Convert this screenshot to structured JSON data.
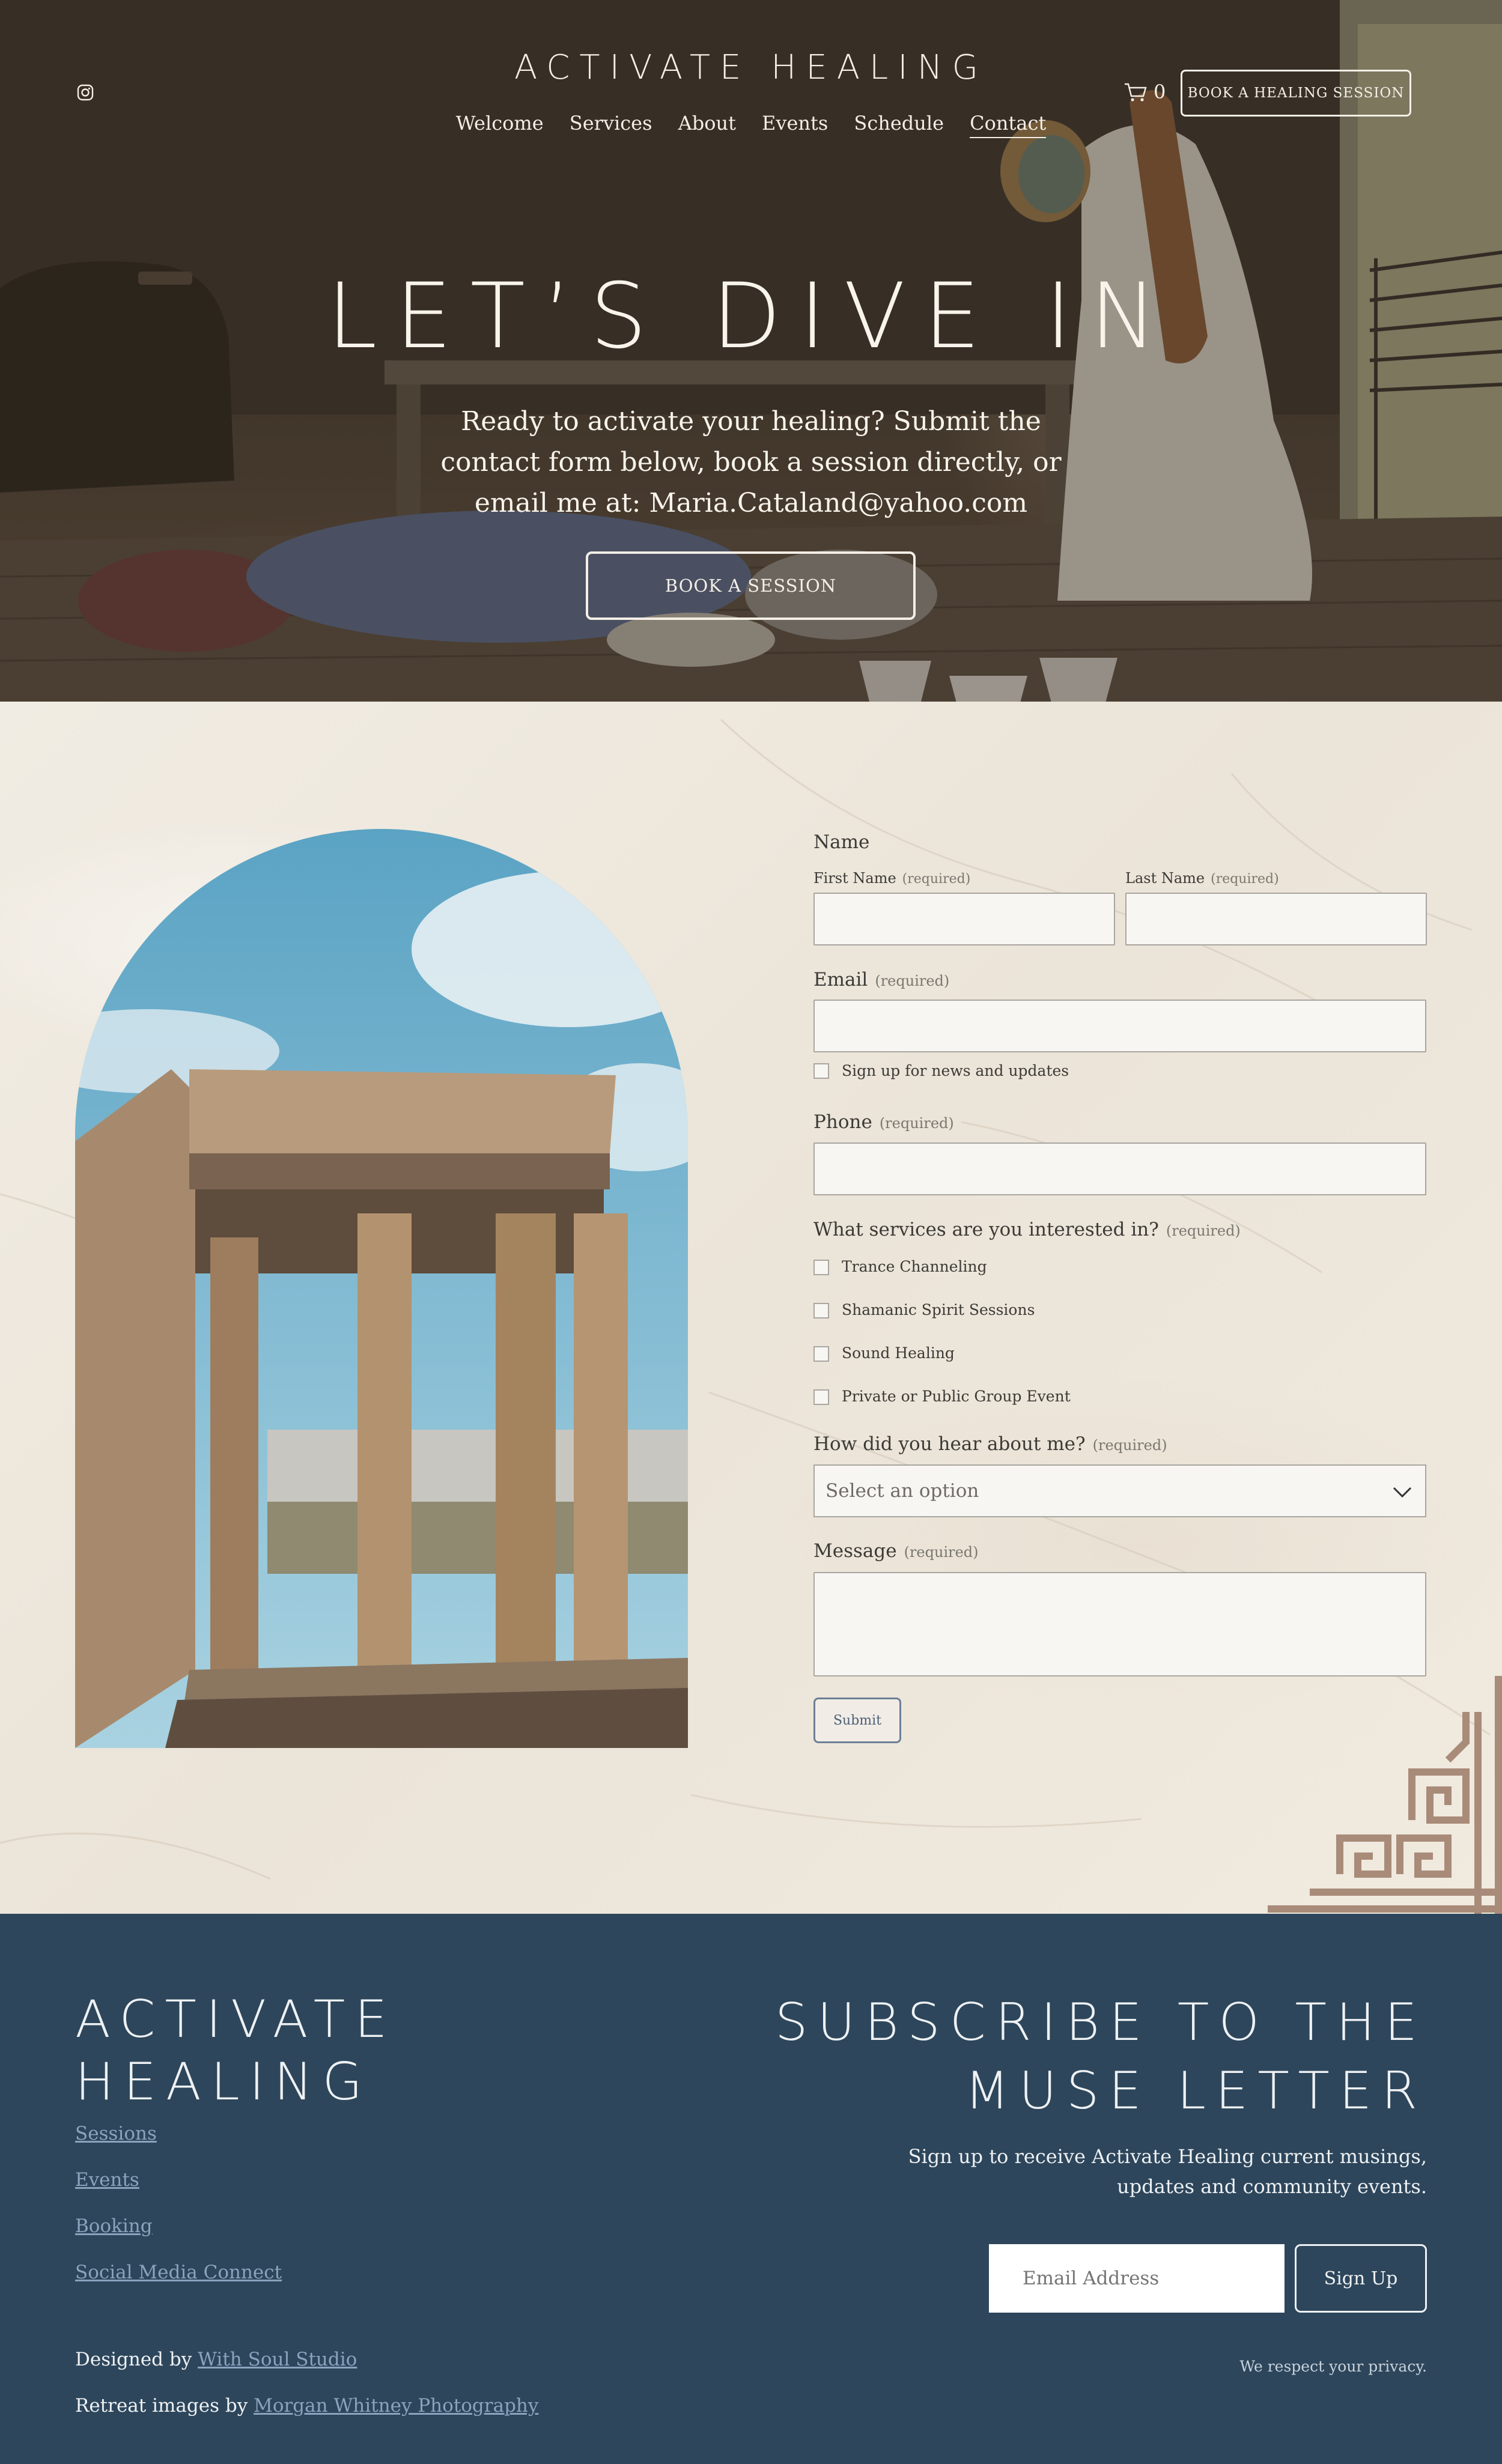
{
  "header": {
    "brand": "ACTIVATE HEALING",
    "nav": [
      "Welcome",
      "Services",
      "About",
      "Events",
      "Schedule",
      "Contact"
    ],
    "active_nav": "Contact",
    "cart_count": "0",
    "book_button": "BOOK A HEALING SESSION"
  },
  "hero": {
    "title": "LET’S DIVE IN",
    "text": "Ready to activate your healing? Submit the contact form below, book a session directly, or email me at: Maria.Cataland@yahoo.com",
    "button": "BOOK A SESSION"
  },
  "form": {
    "name_label": "Name",
    "first_name_label": "First Name",
    "last_name_label": "Last Name",
    "required": "(required)",
    "email_label": "Email",
    "newsletter_label": "Sign up for news and updates",
    "phone_label": "Phone",
    "services_label": "What services are you interested in?",
    "services": [
      "Trance Channeling",
      "Shamanic Spirit Sessions",
      "Sound Healing",
      "Private or Public Group Event"
    ],
    "hear_label": "How did you hear about me?",
    "hear_placeholder": "Select an option",
    "message_label": "Message",
    "submit": "Submit"
  },
  "footer": {
    "brand_line1": "ACTIVATE",
    "brand_line2": "HEALING",
    "links": [
      "Sessions",
      "Events",
      "Booking",
      "Social Media Connect"
    ],
    "subscribe_line1": "SUBSCRIBE TO THE",
    "subscribe_line2": "MUSE LETTER",
    "subscribe_text": "Sign up to receive Activate Healing current musings, updates and community events.",
    "email_placeholder": "Email Address",
    "signup_button": "Sign Up",
    "privacy": "We respect your privacy.",
    "designed_by_prefix": "Designed by",
    "designed_by_link": "With Soul Studio",
    "images_by_prefix": "Retreat images by",
    "images_by_link": "Morgan Whitney Photography"
  },
  "colors": {
    "footer_bg": "#2d465b",
    "footer_link": "#8aa4bf",
    "meander": "#a88b78",
    "submit_border": "#6d7f96"
  }
}
